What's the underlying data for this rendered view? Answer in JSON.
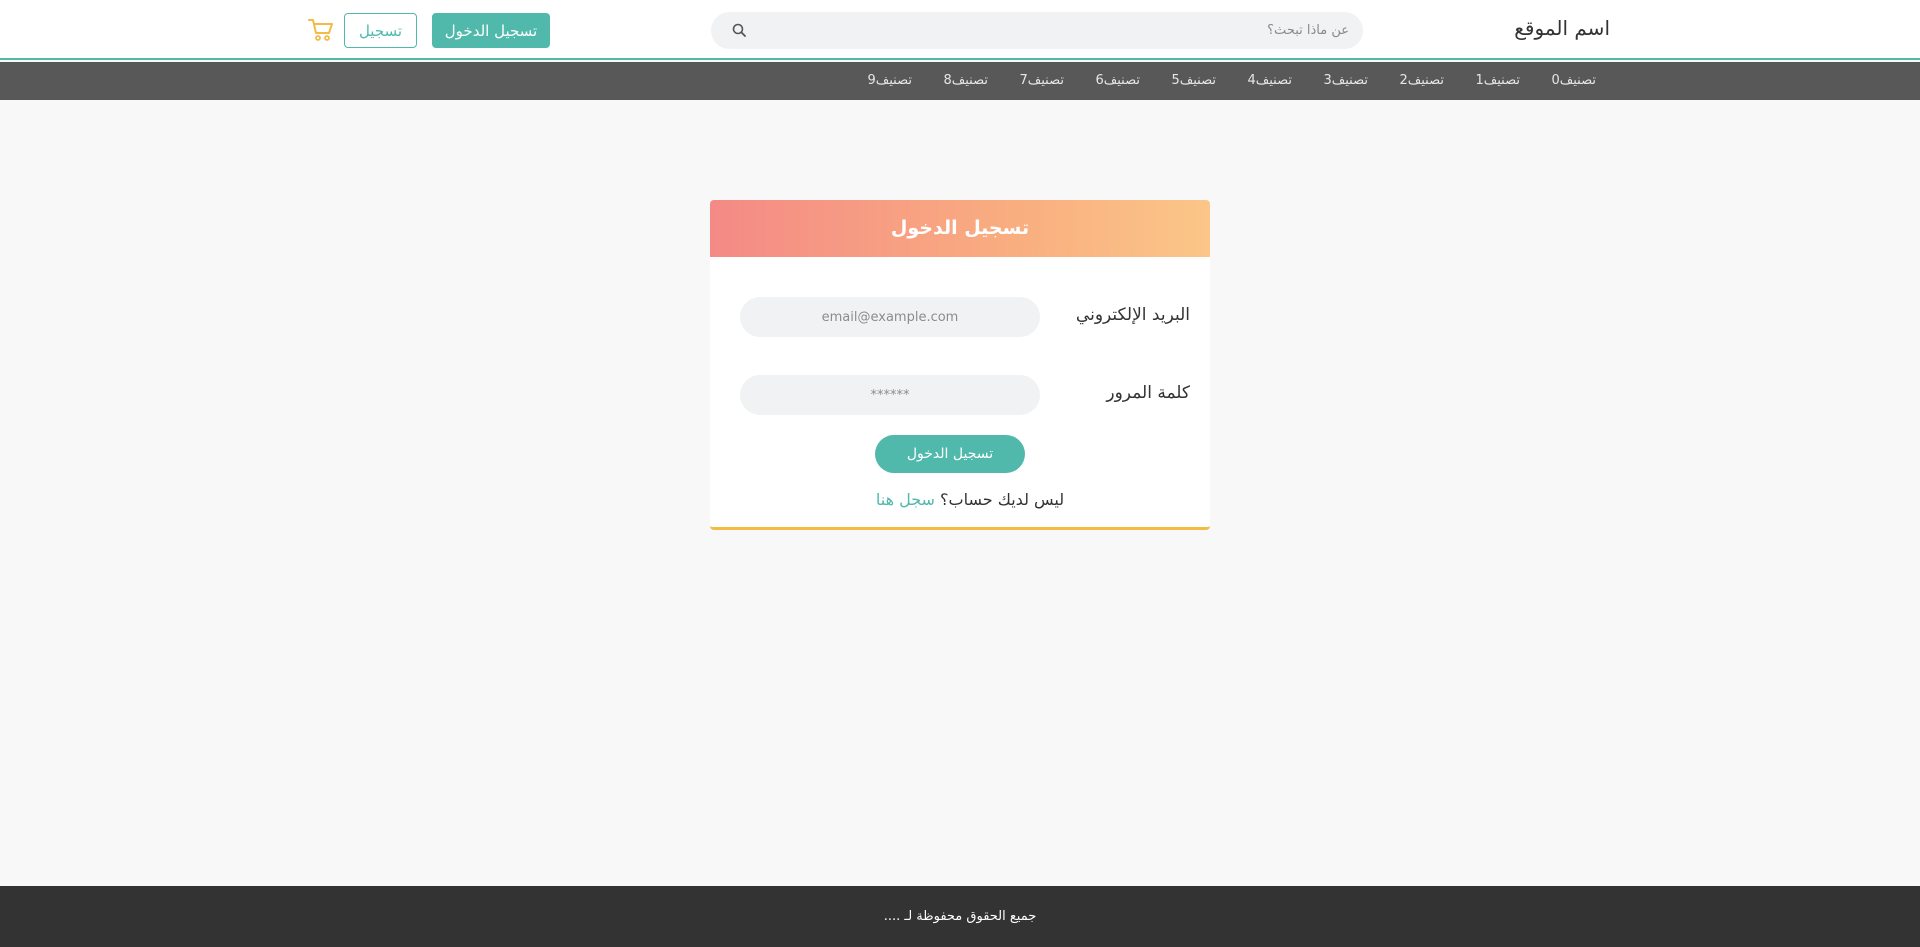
{
  "header": {
    "site_name": "اسم الموقع",
    "search_placeholder": "عن ماذا تبحث؟",
    "login_label": "تسجيل الدخول",
    "register_label": "تسجيل"
  },
  "nav": {
    "items": [
      "تصنيف0",
      "تصنيف1",
      "تصنيف2",
      "تصنيف3",
      "تصنيف4",
      "تصنيف5",
      "تصنيف6",
      "تصنيف7",
      "تصنيف8",
      "تصنيف9"
    ]
  },
  "login_form": {
    "title": "تسجيل الدخول",
    "email_label": "البريد الإلكتروني",
    "email_placeholder": "email@example.com",
    "password_label": "كلمة المرور",
    "password_placeholder": "******",
    "submit_label": "تسجيل الدخول",
    "no_account_text": "ليس لديك حساب؟",
    "signup_link": "سجل هنا"
  },
  "footer": {
    "text": "جميع الحقوق محفوظة لـ ...."
  },
  "colors": {
    "accent": "#50b9ab",
    "nav_bg": "#585858",
    "footer_bg": "#333333",
    "card_border": "#f3bb45",
    "cart": "#f3bb45"
  },
  "icons": {
    "search": "search-icon",
    "cart": "cart-icon"
  }
}
